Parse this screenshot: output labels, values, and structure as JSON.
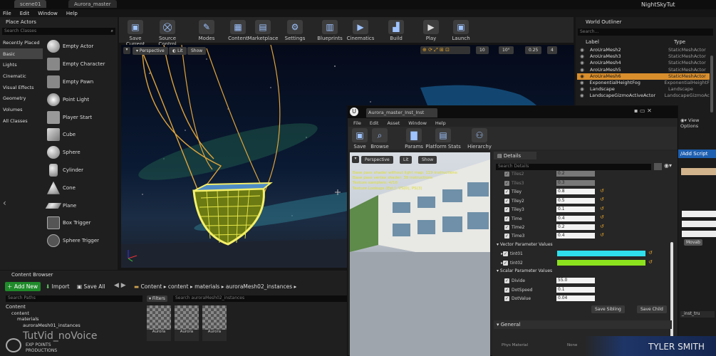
{
  "tabs": {
    "scene": "scene01",
    "material": "Aurora_master"
  },
  "menu": [
    "File",
    "Edit",
    "Window",
    "Help"
  ],
  "project_name": "NightSkyTut",
  "place_actors": {
    "title": "Place Actors",
    "search_placeholder": "Search Classes",
    "categories": [
      "Recently Placed",
      "Basic",
      "Lights",
      "Cinematic",
      "Visual Effects",
      "Geometry",
      "Volumes",
      "All Classes"
    ],
    "items": [
      "Empty Actor",
      "Empty Character",
      "Empty Pawn",
      "Point Light",
      "Player Start",
      "Cube",
      "Sphere",
      "Cylinder",
      "Cone",
      "Plane",
      "Box Trigger",
      "Sphere Trigger"
    ]
  },
  "toolbar": [
    "Save Current",
    "Source Control",
    "Modes",
    "Content",
    "Marketplace",
    "Settings",
    "Blueprints",
    "Cinematics",
    "Build",
    "Play",
    "Launch"
  ],
  "viewport": {
    "perspective": "Perspective",
    "lit": "Lit",
    "show": "Show",
    "grid": "10",
    "angle": "10°",
    "scale": "0.25",
    "camera": "4"
  },
  "world_outliner": {
    "title": "World Outliner",
    "search_placeholder": "Search...",
    "col_label": "Label",
    "col_type": "Type",
    "rows": [
      {
        "label": "AroUraMesh2",
        "type": "StaticMeshActor"
      },
      {
        "label": "AroUraMesh3",
        "type": "StaticMeshActor"
      },
      {
        "label": "AroUraMesh4",
        "type": "StaticMeshActor"
      },
      {
        "label": "AroUraMesh5",
        "type": "StaticMeshActor"
      },
      {
        "label": "AroUraMesh6",
        "type": "StaticMeshActor"
      },
      {
        "label": "ExponentialHeightFog",
        "type": "ExponentialHeightF"
      },
      {
        "label": "Landscape",
        "type": "Landscape"
      },
      {
        "label": "LandscapeGizmoActiveActor",
        "type": "LandscapeGizmoAc"
      }
    ],
    "view_options": "View Options",
    "add_script": "/Add Script",
    "movab": "Movab",
    "inst": "_inst_tru"
  },
  "content_browser": {
    "title": "Content Browser",
    "add_new": "Add New",
    "import": "Import",
    "save_all": "Save All",
    "breadcrumb": [
      "Content",
      "content",
      "materials",
      "auroraMesh02_instances"
    ],
    "search_paths": "Search Paths",
    "filters": "Filters",
    "search_placeholder": "Search auroraMesh02_instances",
    "tree": [
      "Content",
      "content",
      "materials",
      "auroraMesh01_instances"
    ],
    "assets": [
      "Aurora",
      "Aurora",
      "Aurora"
    ]
  },
  "material_window": {
    "tab": "Aurora_master_Inst_Inst",
    "menu": [
      "File",
      "Edit",
      "Asset",
      "Window",
      "Help"
    ],
    "toolbar": [
      "Save",
      "Browse",
      "Params",
      "Platform Stats",
      "Hierarchy"
    ],
    "perspective": "Perspective",
    "lit": "Lit",
    "show": "Show",
    "stats": [
      "Base pass shader without light map: 119 instructions",
      "Base pass vertex shader: 39 instructions",
      "Texture samplers: 4/16",
      "Texture Lookups (Est.): VS(0), PS(3)"
    ]
  },
  "details": {
    "title": "Details",
    "search_placeholder": "Search Details",
    "scalar_top": [
      {
        "name": "Tiles2",
        "value": "0.2"
      },
      {
        "name": "Tiles3",
        "value": "0.3"
      },
      {
        "name": "Tiley",
        "value": "0.8"
      },
      {
        "name": "Tiley2",
        "value": "0.5"
      },
      {
        "name": "Tiley3",
        "value": "0.1"
      },
      {
        "name": "Time",
        "value": "0.4"
      },
      {
        "name": "Time2",
        "value": "0.2"
      },
      {
        "name": "Time3",
        "value": "0.4"
      }
    ],
    "vector_header": "Vector Parameter Values",
    "vectors": [
      {
        "name": "tint01",
        "color": "#2fe0ec"
      },
      {
        "name": "tint02",
        "color": "#8de21e"
      }
    ],
    "scalar_header": "Scalar Parameter Values",
    "scalars": [
      {
        "name": "Divide",
        "value": "55.0"
      },
      {
        "name": "DotSpeed",
        "value": "0.1"
      },
      {
        "name": "DotValue",
        "value": "0.04"
      }
    ],
    "save_sibling": "Save Sibling",
    "save_child": "Save Child",
    "general": "General",
    "phys_material": "Phys Material",
    "none": "None"
  },
  "overlay": {
    "watermark": "TutVid_noVoice",
    "logo_line1": "EXP POINTS",
    "logo_line2": "PRODUCTIONS",
    "author": "TYLER SMITH"
  }
}
